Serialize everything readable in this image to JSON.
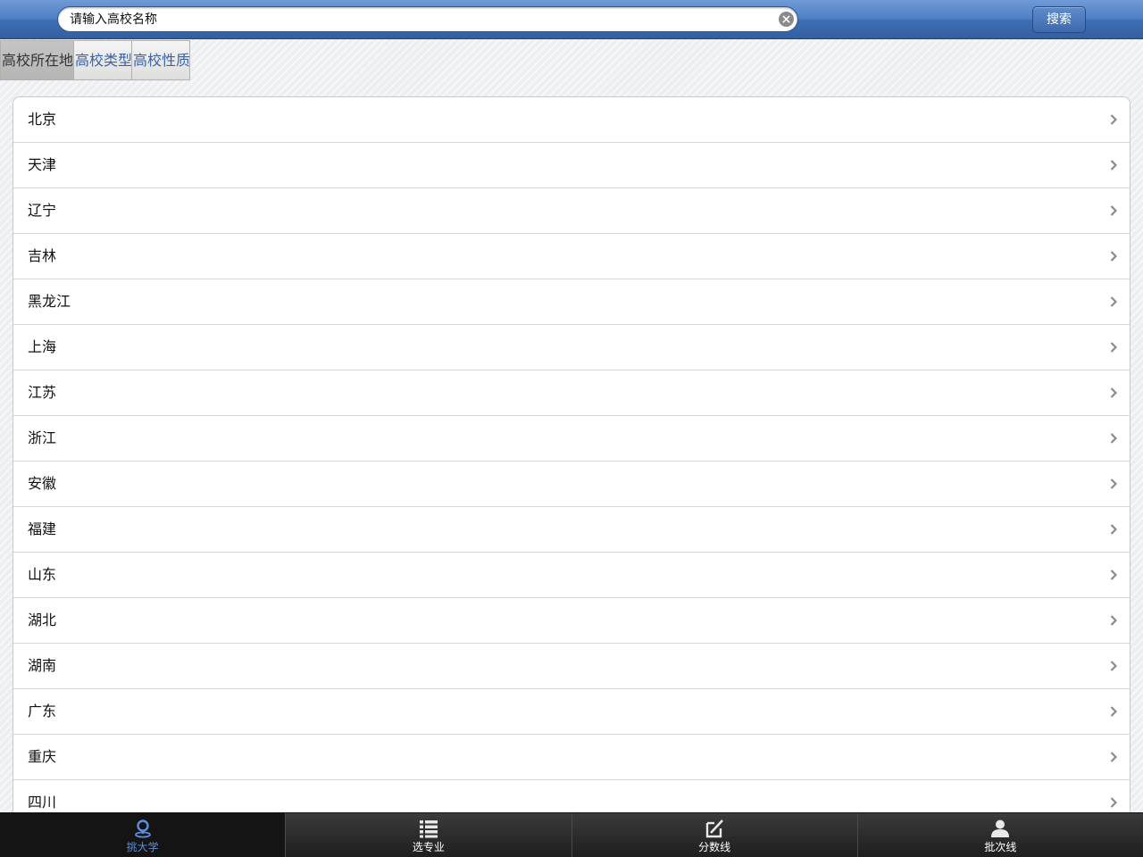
{
  "search": {
    "placeholder": "请输入高校名称",
    "button_label": "搜索"
  },
  "filter_tabs": [
    {
      "label": "高校所在地",
      "active": true
    },
    {
      "label": "高校类型",
      "active": false
    },
    {
      "label": "高校性质",
      "active": false
    }
  ],
  "provinces": [
    "北京",
    "天津",
    "辽宁",
    "吉林",
    "黑龙江",
    "上海",
    "江苏",
    "浙江",
    "安徽",
    "福建",
    "山东",
    "湖北",
    "湖南",
    "广东",
    "重庆",
    "四川"
  ],
  "bottom_tabs": [
    {
      "label": "挑大学",
      "icon": "pin-icon",
      "active": true
    },
    {
      "label": "选专业",
      "icon": "list-icon",
      "active": false
    },
    {
      "label": "分数线",
      "icon": "edit-icon",
      "active": false
    },
    {
      "label": "批次线",
      "icon": "user-icon",
      "active": false
    }
  ],
  "colors": {
    "accent": "#5b8fdc",
    "link": "#3a62a7",
    "topbar": "#4d7fc4"
  }
}
